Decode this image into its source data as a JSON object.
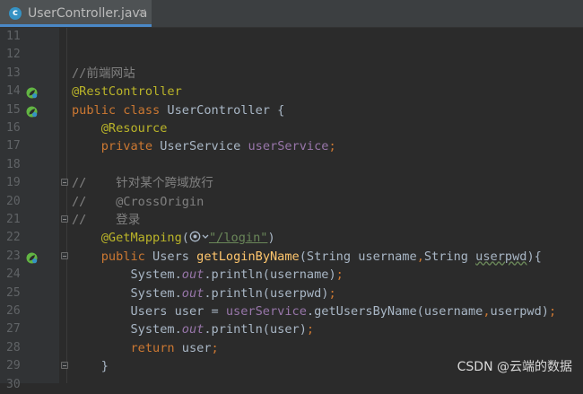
{
  "tab": {
    "title": "UserController.java",
    "icon_letter": "c",
    "close_glyph": "×"
  },
  "colors": {
    "background": "#2b2b2b",
    "gutter": "#313335",
    "keyword": "#cc7832",
    "annotation": "#bbb529",
    "comment": "#808080",
    "field": "#9876aa",
    "method": "#ffc66d",
    "string": "#6a8759",
    "text": "#a9b7c6"
  },
  "gutter_icons": {
    "14": "spring-bean-icon",
    "15": "spring-bean-icon",
    "23": "spring-bean-icon"
  },
  "fold_lines": [
    "19",
    "21",
    "23",
    "29"
  ],
  "lines": [
    {
      "n": "11",
      "seg": []
    },
    {
      "n": "12",
      "seg": []
    },
    {
      "n": "13",
      "seg": [
        [
          "comment",
          "//前端网站"
        ]
      ]
    },
    {
      "n": "14",
      "seg": [
        [
          "anno",
          "@RestController"
        ]
      ]
    },
    {
      "n": "15",
      "seg": [
        [
          "kw",
          "public class "
        ],
        [
          "plain",
          "UserController {"
        ]
      ]
    },
    {
      "n": "16",
      "seg": [
        [
          "plain",
          "    "
        ],
        [
          "anno",
          "@Resource"
        ]
      ]
    },
    {
      "n": "17",
      "seg": [
        [
          "plain",
          "    "
        ],
        [
          "kw",
          "private "
        ],
        [
          "plain",
          "UserService "
        ],
        [
          "field",
          "userService"
        ],
        [
          "kw",
          ";"
        ]
      ]
    },
    {
      "n": "18",
      "seg": []
    },
    {
      "n": "19",
      "seg": [
        [
          "comment",
          "//    针对某个跨域放行"
        ]
      ]
    },
    {
      "n": "20",
      "seg": [
        [
          "comment",
          "//    @CrossOrigin"
        ]
      ]
    },
    {
      "n": "21",
      "seg": [
        [
          "comment",
          "//    登录"
        ]
      ]
    },
    {
      "n": "22",
      "seg": [
        [
          "plain",
          "    "
        ],
        [
          "anno",
          "@GetMapping"
        ],
        [
          "plain",
          "("
        ],
        [
          "badge",
          ""
        ],
        [
          "str",
          "\"/login\""
        ],
        [
          "plain",
          ")"
        ]
      ]
    },
    {
      "n": "23",
      "seg": [
        [
          "plain",
          "    "
        ],
        [
          "kw",
          "public "
        ],
        [
          "plain",
          "Users "
        ],
        [
          "method",
          "getLoginByName"
        ],
        [
          "plain",
          "(String username"
        ],
        [
          "kw",
          ","
        ],
        [
          "plain",
          "String "
        ],
        [
          "typo",
          "userpwd"
        ],
        [
          "plain",
          "){"
        ]
      ]
    },
    {
      "n": "24",
      "seg": [
        [
          "plain",
          "        System."
        ],
        [
          "static",
          "out"
        ],
        [
          "plain",
          ".println(username)"
        ],
        [
          "kw",
          ";"
        ]
      ]
    },
    {
      "n": "25",
      "seg": [
        [
          "plain",
          "        System."
        ],
        [
          "static",
          "out"
        ],
        [
          "plain",
          ".println(userpwd)"
        ],
        [
          "kw",
          ";"
        ]
      ]
    },
    {
      "n": "26",
      "seg": [
        [
          "plain",
          "        Users user = "
        ],
        [
          "field",
          "userService"
        ],
        [
          "plain",
          ".getUsersByName(username"
        ],
        [
          "kw",
          ","
        ],
        [
          "plain",
          "userpwd)"
        ],
        [
          "kw",
          ";"
        ]
      ]
    },
    {
      "n": "27",
      "seg": [
        [
          "plain",
          "        System."
        ],
        [
          "static",
          "out"
        ],
        [
          "plain",
          ".println(user)"
        ],
        [
          "kw",
          ";"
        ]
      ]
    },
    {
      "n": "28",
      "seg": [
        [
          "plain",
          "        "
        ],
        [
          "kw",
          "return "
        ],
        [
          "plain",
          "user"
        ],
        [
          "kw",
          ";"
        ]
      ]
    },
    {
      "n": "29",
      "seg": [
        [
          "plain",
          "    }"
        ]
      ]
    },
    {
      "n": "30",
      "seg": []
    }
  ],
  "watermark": "CSDN @云端的数据"
}
